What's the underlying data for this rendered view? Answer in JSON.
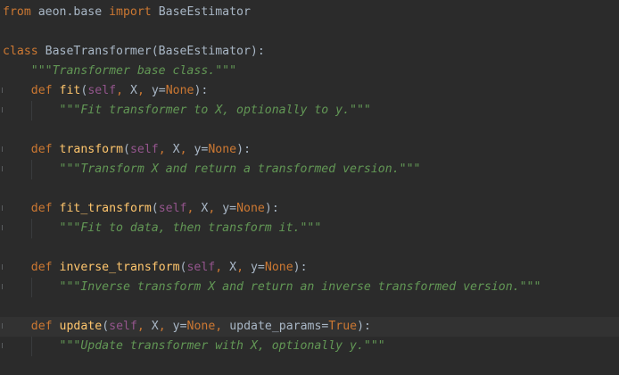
{
  "editor": {
    "colors": {
      "background": "#2b2b2b",
      "active_line": "#323232",
      "plain": "#a9b7c6",
      "keyword": "#cc7832",
      "self": "#94558d",
      "function": "#ffc66d",
      "docstring": "#629755"
    },
    "lines": [
      {
        "tokens": [
          {
            "t": "keyword",
            "v": "from"
          },
          {
            "t": "plain",
            "v": " aeon.base "
          },
          {
            "t": "keyword",
            "v": "import"
          },
          {
            "t": "plain",
            "v": " BaseEstimator"
          }
        ]
      },
      {
        "tokens": []
      },
      {
        "tokens": [
          {
            "t": "keyword",
            "v": "class"
          },
          {
            "t": "plain",
            "v": " BaseTransformer(BaseEstimator):"
          }
        ]
      },
      {
        "tokens": [
          {
            "t": "plain",
            "v": "    "
          },
          {
            "t": "doc",
            "v": "\"\"\"Transformer base class.\"\"\""
          }
        ]
      },
      {
        "tokens": [
          {
            "t": "plain",
            "v": "    "
          },
          {
            "t": "keyword",
            "v": "def"
          },
          {
            "t": "plain",
            "v": " "
          },
          {
            "t": "func",
            "v": "fit"
          },
          {
            "t": "plain",
            "v": "("
          },
          {
            "t": "self",
            "v": "self"
          },
          {
            "t": "keyword",
            "v": ", "
          },
          {
            "t": "plain",
            "v": "X"
          },
          {
            "t": "keyword",
            "v": ", "
          },
          {
            "t": "plain",
            "v": "y="
          },
          {
            "t": "keyword",
            "v": "None"
          },
          {
            "t": "plain",
            "v": "):"
          }
        ]
      },
      {
        "tokens": [
          {
            "t": "plain",
            "v": "        "
          },
          {
            "t": "doc",
            "v": "\"\"\"Fit transformer to X, optionally to y.\"\"\""
          }
        ]
      },
      {
        "tokens": []
      },
      {
        "tokens": [
          {
            "t": "plain",
            "v": "    "
          },
          {
            "t": "keyword",
            "v": "def"
          },
          {
            "t": "plain",
            "v": " "
          },
          {
            "t": "func",
            "v": "transform"
          },
          {
            "t": "plain",
            "v": "("
          },
          {
            "t": "self",
            "v": "self"
          },
          {
            "t": "keyword",
            "v": ", "
          },
          {
            "t": "plain",
            "v": "X"
          },
          {
            "t": "keyword",
            "v": ", "
          },
          {
            "t": "plain",
            "v": "y="
          },
          {
            "t": "keyword",
            "v": "None"
          },
          {
            "t": "plain",
            "v": "):"
          }
        ]
      },
      {
        "tokens": [
          {
            "t": "plain",
            "v": "        "
          },
          {
            "t": "doc",
            "v": "\"\"\"Transform X and return a transformed version.\"\"\""
          }
        ]
      },
      {
        "tokens": []
      },
      {
        "tokens": [
          {
            "t": "plain",
            "v": "    "
          },
          {
            "t": "keyword",
            "v": "def"
          },
          {
            "t": "plain",
            "v": " "
          },
          {
            "t": "func",
            "v": "fit_transform"
          },
          {
            "t": "plain",
            "v": "("
          },
          {
            "t": "self",
            "v": "self"
          },
          {
            "t": "keyword",
            "v": ", "
          },
          {
            "t": "plain",
            "v": "X"
          },
          {
            "t": "keyword",
            "v": ", "
          },
          {
            "t": "plain",
            "v": "y="
          },
          {
            "t": "keyword",
            "v": "None"
          },
          {
            "t": "plain",
            "v": "):"
          }
        ]
      },
      {
        "tokens": [
          {
            "t": "plain",
            "v": "        "
          },
          {
            "t": "doc",
            "v": "\"\"\"Fit to data, then transform it.\"\"\""
          }
        ]
      },
      {
        "tokens": []
      },
      {
        "tokens": [
          {
            "t": "plain",
            "v": "    "
          },
          {
            "t": "keyword",
            "v": "def"
          },
          {
            "t": "plain",
            "v": " "
          },
          {
            "t": "func",
            "v": "inverse_transform"
          },
          {
            "t": "plain",
            "v": "("
          },
          {
            "t": "self",
            "v": "self"
          },
          {
            "t": "keyword",
            "v": ", "
          },
          {
            "t": "plain",
            "v": "X"
          },
          {
            "t": "keyword",
            "v": ", "
          },
          {
            "t": "plain",
            "v": "y="
          },
          {
            "t": "keyword",
            "v": "None"
          },
          {
            "t": "plain",
            "v": "):"
          }
        ]
      },
      {
        "tokens": [
          {
            "t": "plain",
            "v": "        "
          },
          {
            "t": "doc",
            "v": "\"\"\"Inverse transform X and return an inverse transformed version.\"\"\""
          }
        ]
      },
      {
        "tokens": []
      },
      {
        "active": true,
        "tokens": [
          {
            "t": "plain",
            "v": "    "
          },
          {
            "t": "keyword",
            "v": "def"
          },
          {
            "t": "plain",
            "v": " "
          },
          {
            "t": "func",
            "v": "update"
          },
          {
            "t": "plain",
            "v": "("
          },
          {
            "t": "self",
            "v": "self"
          },
          {
            "t": "keyword",
            "v": ", "
          },
          {
            "t": "plain",
            "v": "X"
          },
          {
            "t": "keyword",
            "v": ", "
          },
          {
            "t": "plain",
            "v": "y="
          },
          {
            "t": "keyword",
            "v": "None"
          },
          {
            "t": "keyword",
            "v": ", "
          },
          {
            "t": "plain",
            "v": "update_params="
          },
          {
            "t": "keyword",
            "v": "True"
          },
          {
            "t": "plain",
            "v": "):"
          }
        ]
      },
      {
        "tokens": [
          {
            "t": "plain",
            "v": "        "
          },
          {
            "t": "doc",
            "v": "\"\"\"Update transformer with X, optionally y.\"\"\""
          }
        ]
      }
    ]
  }
}
